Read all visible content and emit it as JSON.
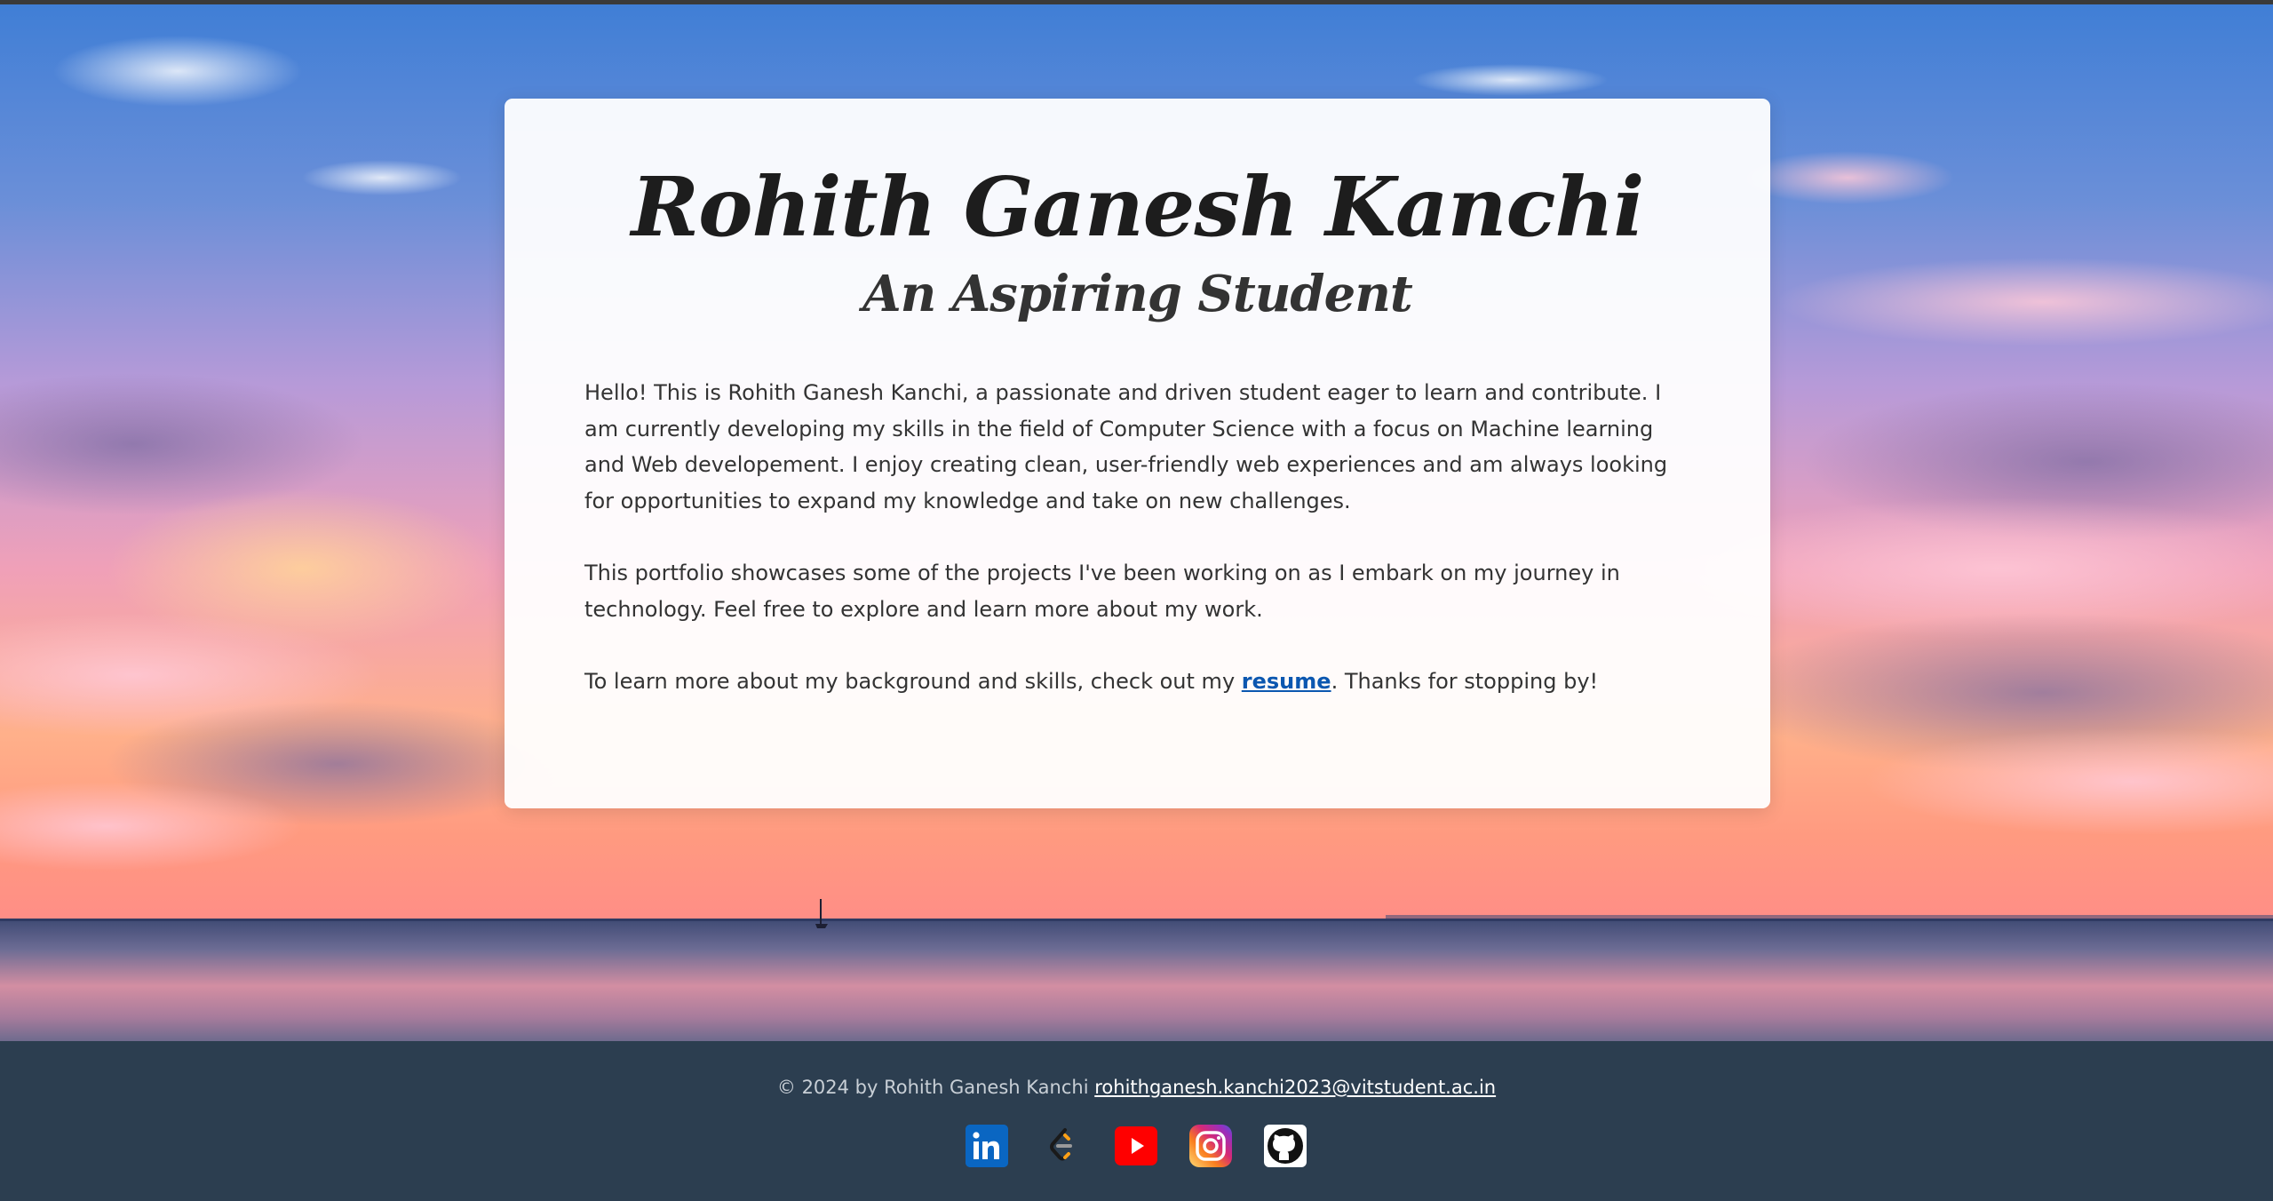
{
  "profile": {
    "name": "Rohith Ganesh Kanchi",
    "tagline": "An Aspiring Student"
  },
  "about": {
    "para1": "Hello! This is Rohith Ganesh Kanchi, a passionate and driven student eager to learn and contribute. I am currently developing my skills in the field of Computer Science with a focus on Machine learning and Web developement. I enjoy creating clean, user-friendly web experiences and am always looking for opportunities to expand my knowledge and take on new challenges.",
    "para2": "This portfolio showcases some of the projects I've been working on as I embark on my journey in technology. Feel free to explore and learn more about my work.",
    "para3_before": "To learn more about my background and skills, check out my ",
    "resume_link": "resume",
    "para3_after": ". Thanks for stopping by!"
  },
  "footer": {
    "copyright": "© 2024 by Rohith Ganesh Kanchi",
    "email": "rohithganesh.kanchi2023@vitstudent.ac.in",
    "socials": [
      {
        "icon": "linkedin-icon",
        "color": "#0a66c2"
      },
      {
        "icon": "leetcode-icon",
        "color": "#ffa116"
      },
      {
        "icon": "youtube-icon",
        "color": "#ff0000"
      },
      {
        "icon": "instagram-icon",
        "color": "#e1306c"
      },
      {
        "icon": "github-icon",
        "color": "#000000"
      }
    ]
  },
  "colors": {
    "footer_bg": "#2c3e50",
    "link": "#0b57b0"
  }
}
